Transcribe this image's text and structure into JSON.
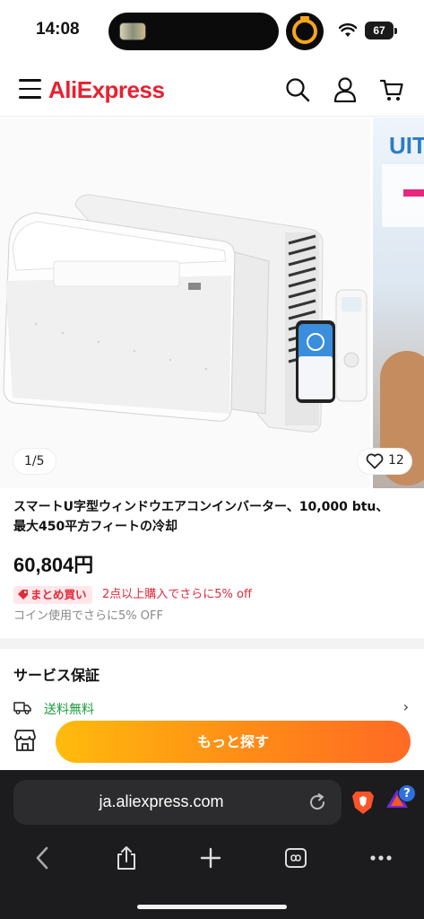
{
  "status_bar": {
    "time": "14:08",
    "battery": "67"
  },
  "header": {
    "logo": "AliExpress",
    "icons": [
      "menu-icon",
      "search-icon",
      "account-icon",
      "cart-icon"
    ]
  },
  "gallery": {
    "counter": "1/5",
    "likes": "12",
    "next_slide_text": "UIT"
  },
  "product": {
    "title": "スマートU字型ウィンドウエアコンインバーター、10,000 btu、最大450平方フィートの冷却",
    "price": "60,804円",
    "bundle_badge": "まとめ買い",
    "bundle_offer": "2点以上購入でさらに5% off",
    "coin_offer": "コイン使用でさらに5% OFF"
  },
  "service": {
    "title": "サービス保証",
    "shipping": "送料無料",
    "more_button": "もっと探す"
  },
  "browser": {
    "url": "ja.aliexpress.com",
    "rewards_badge": "?"
  },
  "colors": {
    "brand": "#e8202f",
    "price_red": "#e02a3c",
    "shipping_green": "#1a9b3b",
    "button_start": "#ffbb0d",
    "button_end": "#ff6a24"
  }
}
